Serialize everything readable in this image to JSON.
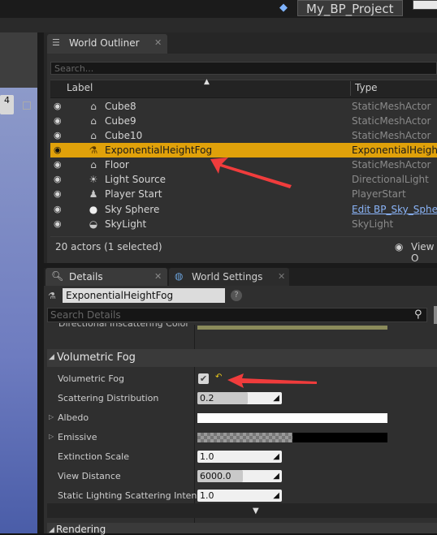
{
  "window": {
    "project_name": "My_BP_Project",
    "viewport_number": "4"
  },
  "outliner": {
    "tab_label": "World Outliner",
    "search_placeholder": "Search...",
    "columns": {
      "label": "Label",
      "type": "Type"
    },
    "actors": [
      {
        "name": "Cube8",
        "type": "StaticMeshActor",
        "icon": "static-mesh-icon",
        "selected": false,
        "link": false
      },
      {
        "name": "Cube9",
        "type": "StaticMeshActor",
        "icon": "static-mesh-icon",
        "selected": false,
        "link": false
      },
      {
        "name": "Cube10",
        "type": "StaticMeshActor",
        "icon": "static-mesh-icon",
        "selected": false,
        "link": false
      },
      {
        "name": "ExponentialHeightFog",
        "type": "ExponentialHeightF",
        "icon": "fog-icon",
        "selected": true,
        "link": false
      },
      {
        "name": "Floor",
        "type": "StaticMeshActor",
        "icon": "static-mesh-icon",
        "selected": false,
        "link": false
      },
      {
        "name": "Light Source",
        "type": "DirectionalLight",
        "icon": "directional-light-icon",
        "selected": false,
        "link": false
      },
      {
        "name": "Player Start",
        "type": "PlayerStart",
        "icon": "player-start-icon",
        "selected": false,
        "link": false
      },
      {
        "name": "Sky Sphere",
        "type": "Edit BP_Sky_Sphe",
        "icon": "sphere-icon",
        "selected": false,
        "link": true
      },
      {
        "name": "SkyLight",
        "type": "SkyLight",
        "icon": "skylight-icon",
        "selected": false,
        "link": false
      }
    ],
    "footer_count": "20 actors (1 selected)",
    "view_options": "View O"
  },
  "details": {
    "tab_label": "Details",
    "world_settings_tab": "World Settings",
    "object_name": "ExponentialHeightFog",
    "search_placeholder": "Search Details",
    "clipped_property": "Directional Inscattering Color",
    "category": "Volumetric Fog",
    "properties": {
      "volumetric_fog": {
        "label": "Volumetric Fog",
        "checked": true
      },
      "scattering_distribution": {
        "label": "Scattering Distribution",
        "value": "0.2"
      },
      "albedo": {
        "label": "Albedo",
        "color": "#ffffff"
      },
      "emissive": {
        "label": "Emissive",
        "color": "#000000"
      },
      "extinction_scale": {
        "label": "Extinction Scale",
        "value": "1.0"
      },
      "view_distance": {
        "label": "View Distance",
        "value": "6000.0"
      },
      "static_lighting": {
        "label": "Static Lighting Scattering Intensit",
        "value": "1.0"
      }
    },
    "next_category": "Rendering"
  },
  "colors": {
    "selection": "#e0a10a",
    "annotation_arrow": "#f03c3c",
    "reset_arrow": "#e8c81c"
  }
}
